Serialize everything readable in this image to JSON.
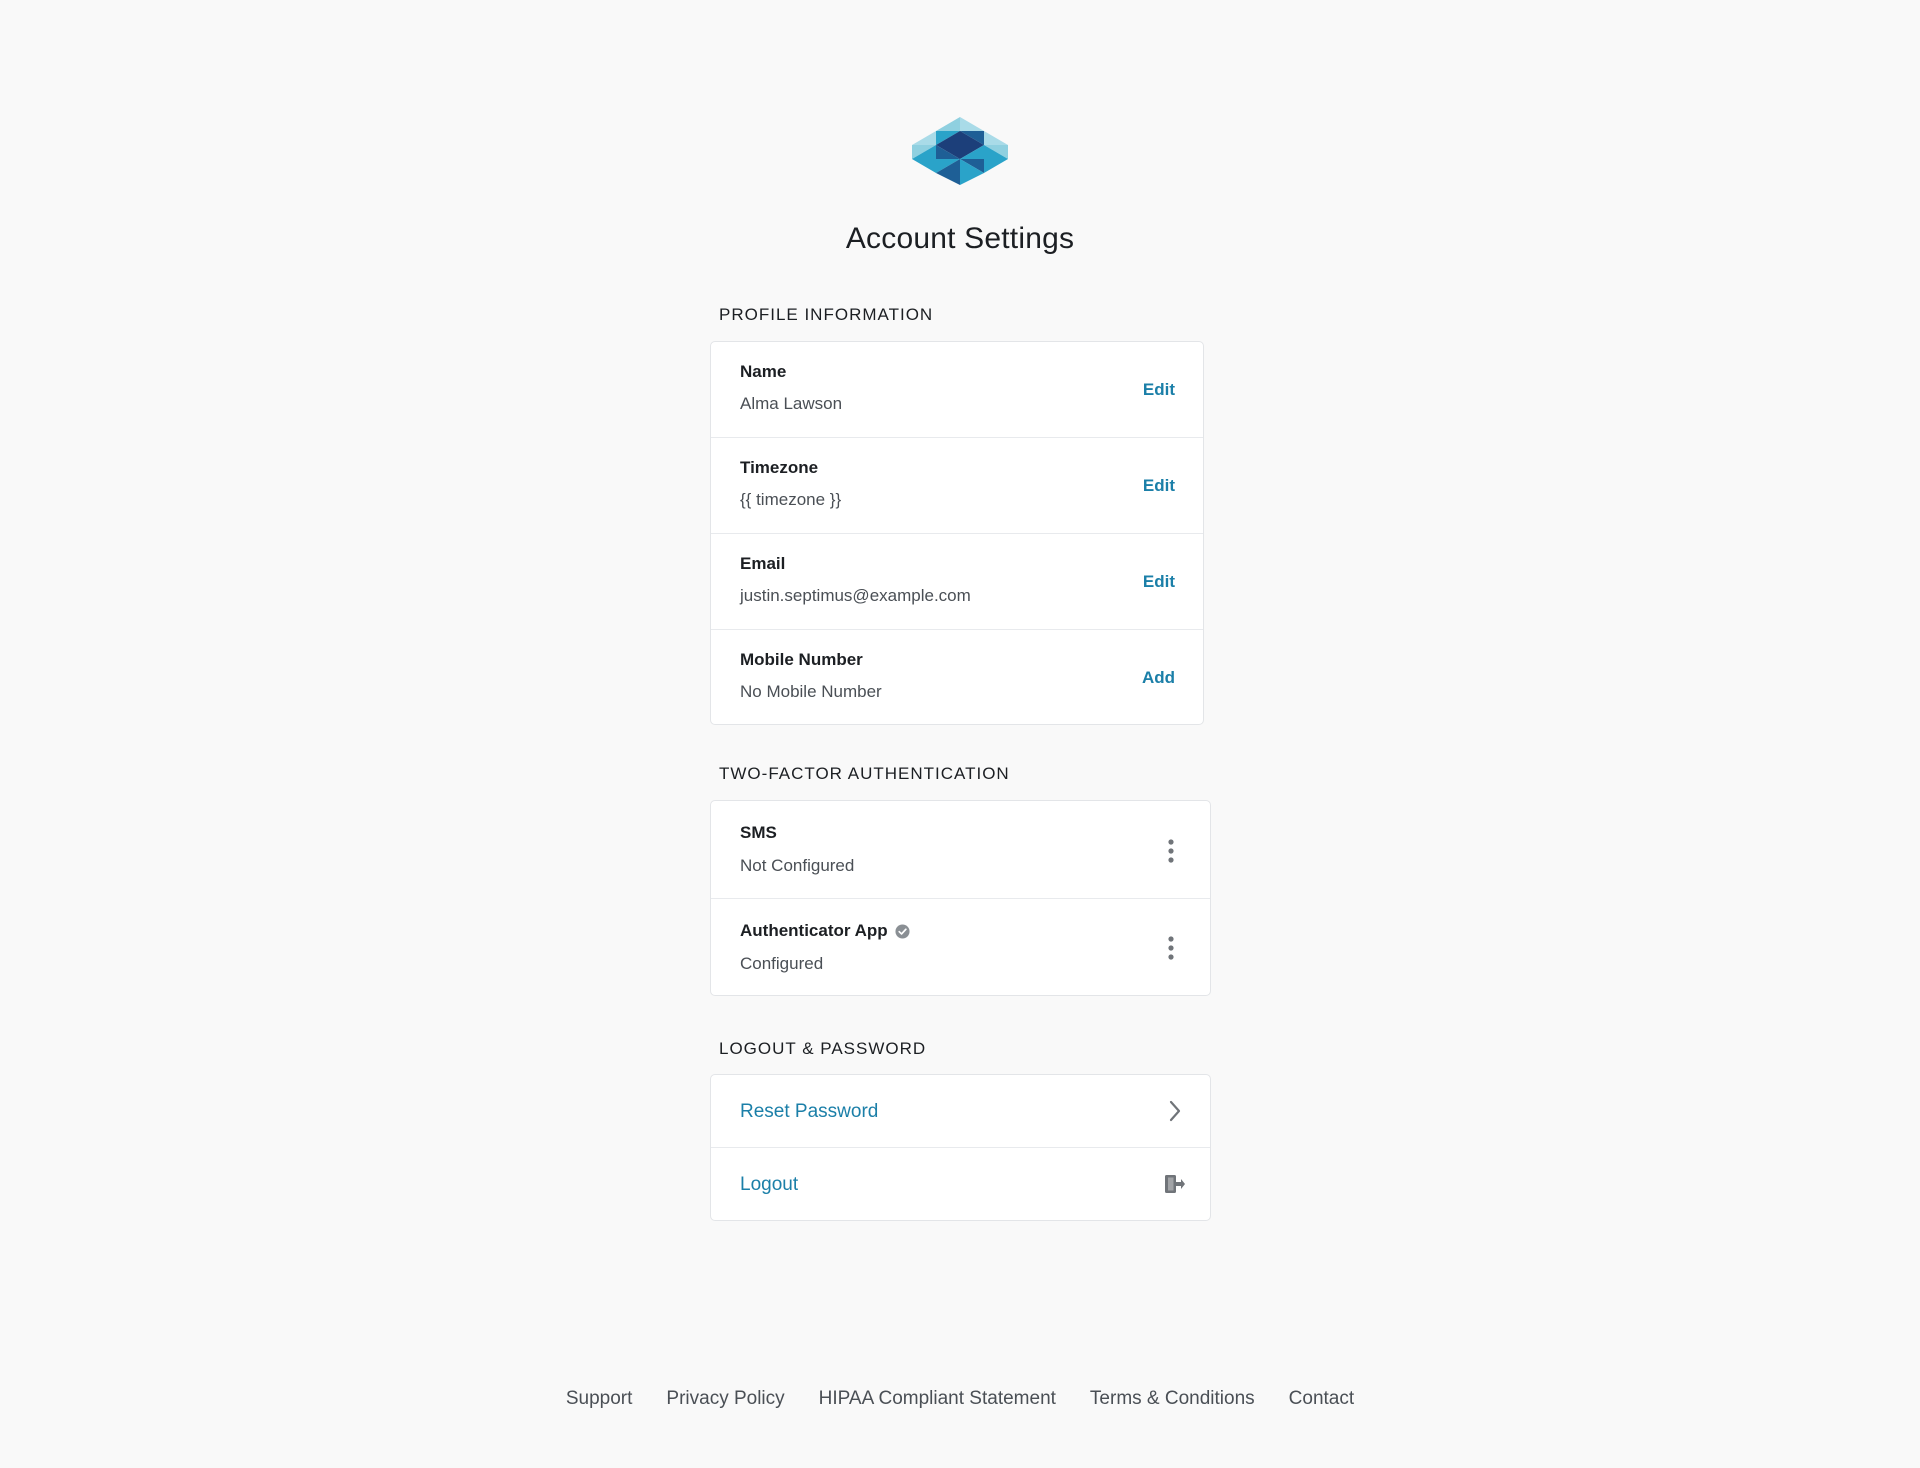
{
  "page": {
    "title": "Account Settings"
  },
  "colors": {
    "accent": "#1b7fa8",
    "background": "#f9f9f9",
    "logo_light": "#8fd0e0",
    "logo_mid": "#2aa3c9",
    "logo_dark": "#1e5f96",
    "logo_darkest": "#1c3f7a"
  },
  "profile": {
    "section_label": "PROFILE INFORMATION",
    "rows": [
      {
        "title": "Name",
        "value": "Alma Lawson",
        "action": "Edit"
      },
      {
        "title": "Timezone",
        "value": "{{ timezone }}",
        "action": "Edit"
      },
      {
        "title": "Email",
        "value": "justin.septimus@example.com",
        "action": "Edit"
      },
      {
        "title": "Mobile Number",
        "value": "No Mobile Number",
        "action": "Add"
      }
    ]
  },
  "two_factor": {
    "section_label": "TWO-FACTOR AUTHENTICATION",
    "rows": [
      {
        "title": "SMS",
        "value": "Not Configured",
        "verified": false,
        "menu_icon": "kebab-menu-icon"
      },
      {
        "title": "Authenticator App",
        "value": "Configured",
        "verified": true,
        "menu_icon": "kebab-menu-icon"
      }
    ]
  },
  "logout_password": {
    "section_label": "LOGOUT & PASSWORD",
    "rows": [
      {
        "label": "Reset Password",
        "icon": "chevron-right-icon"
      },
      {
        "label": "Logout",
        "icon": "logout-icon"
      }
    ]
  },
  "footer": {
    "links": [
      "Support",
      "Privacy Policy",
      "HIPAA Compliant Statement",
      "Terms & Conditions",
      "Contact"
    ]
  }
}
